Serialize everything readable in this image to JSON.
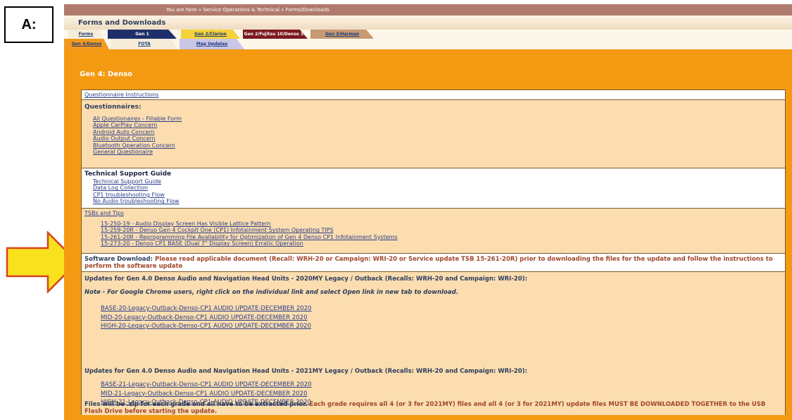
{
  "label": "A:",
  "breadcrumb": "You are here » Service Operations & Technical » Forms/Downloads",
  "page_title": "Forms and Downloads",
  "tabs_row1": [
    {
      "label": "Forms",
      "style": "light"
    },
    {
      "label": "Gen 1",
      "style": "navy"
    },
    {
      "label": "Gen 2/Clarion",
      "style": "yellow"
    },
    {
      "label": "Gen 2/Fujitsu 10/Denso 10",
      "style": "maroon"
    },
    {
      "label": "Gen 3/Harman",
      "style": "tan"
    }
  ],
  "tabs_row2": [
    {
      "label": "Gen 4/Denso",
      "style": "orange"
    },
    {
      "label": "FOTA",
      "style": "light"
    },
    {
      "label": "Map Updates",
      "style": "lav"
    }
  ],
  "section_title": "Gen 4: Denso",
  "questionnaire_instructions": "Questionnaire Instructions",
  "questionnaires": {
    "heading": "Questionnaires:",
    "items": [
      "All Questionaires - Fillable Form",
      "Apple CarPlay Concern",
      "Android Auto Concern",
      "Audio Output Concern",
      "Bluetooth Operation Concern",
      "General Questionaire"
    ]
  },
  "tech_support": {
    "heading": "Technical Support Guide",
    "items": [
      "Technical Support Guide",
      "Data Log Collection",
      "CP1 troubleshooting Flow",
      "No Audio troubleshooting Flow"
    ]
  },
  "tsbs": {
    "heading": "TSBs and Tips",
    "items": [
      "15-250-19 - Audio Display Screen Has Visible Lattice Pattern",
      "15-259-20R - Denso Gen 4 Cockpit One (CP1) Infotainment System Operating TIPS",
      "15-261-20R - Reprogramming File Availability for Optimization of Gen 4 Denso CP1 Infotainment Systems",
      "15-273-20 - Denso CP1 BASE (Dual 7\" Display Screen) Erratic Operation"
    ]
  },
  "software_download": {
    "label": "Software Download:",
    "text": "Please read applicable document (Recall: WRH-20 or Campaign: WRI-20 or Service update TSB 15-261-20R) prior to downloading the files for the update and follow the instructions to perform the software update"
  },
  "updates": {
    "heading_2020": "Updates for Gen 4.0 Denso Audio and Navigation Head Units - 2020MY Legacy / Outback (Recalls: WRH-20 and Campaign: WRI-20):",
    "note": "Note - For Google Chrome users, right click on the individual link and select Open link in new tab to download.",
    "links_2020": [
      "BASE-20-Legacy-Outback-Denso-CP1 AUDIO UPDATE-DECEMBER 2020",
      "MID-20-Legacy-Outback-Denso-CP1 AUDIO UPDATE-DECEMBER 2020",
      "HIGH-20-Legacy-Outback-Denso-CP1 AUDIO UPDATE-DECEMBER 2020"
    ],
    "heading_2021": "Updates for Gen 4.0 Denso Audio and Navigation Head Units - 2021MY Legacy / Outback (Recalls: WRH-20 and Campaign: WRI-20):",
    "links_2021": [
      "BASE-21-Legacy-Outback-Denso-CP1 AUDIO UPDATE-DECEMBER 2020",
      "MID-21-Legacy-Outback-Denso-CP1 AUDIO UPDATE-DECEMBER 2020",
      "HIGH-21-Legacy-Outback-Denso-CP1 AUDIO UPDATE-DECEMBER 2020"
    ],
    "footer_part1": "Files will be .zip for each grade and all have to be extracted prior.",
    "footer_part2": "Each grade requires all 4 (or 3 for 2021MY) files and all 4 (or 3 for 2021MY) update files MUST BE DOWNLOADED TOGETHER to the USB Flash Drive before starting the update."
  },
  "colors": {
    "orange": "#f39a12",
    "peach": "#fbddb0",
    "arrow": "#f7e21d",
    "arrow_border": "#d8421f"
  }
}
